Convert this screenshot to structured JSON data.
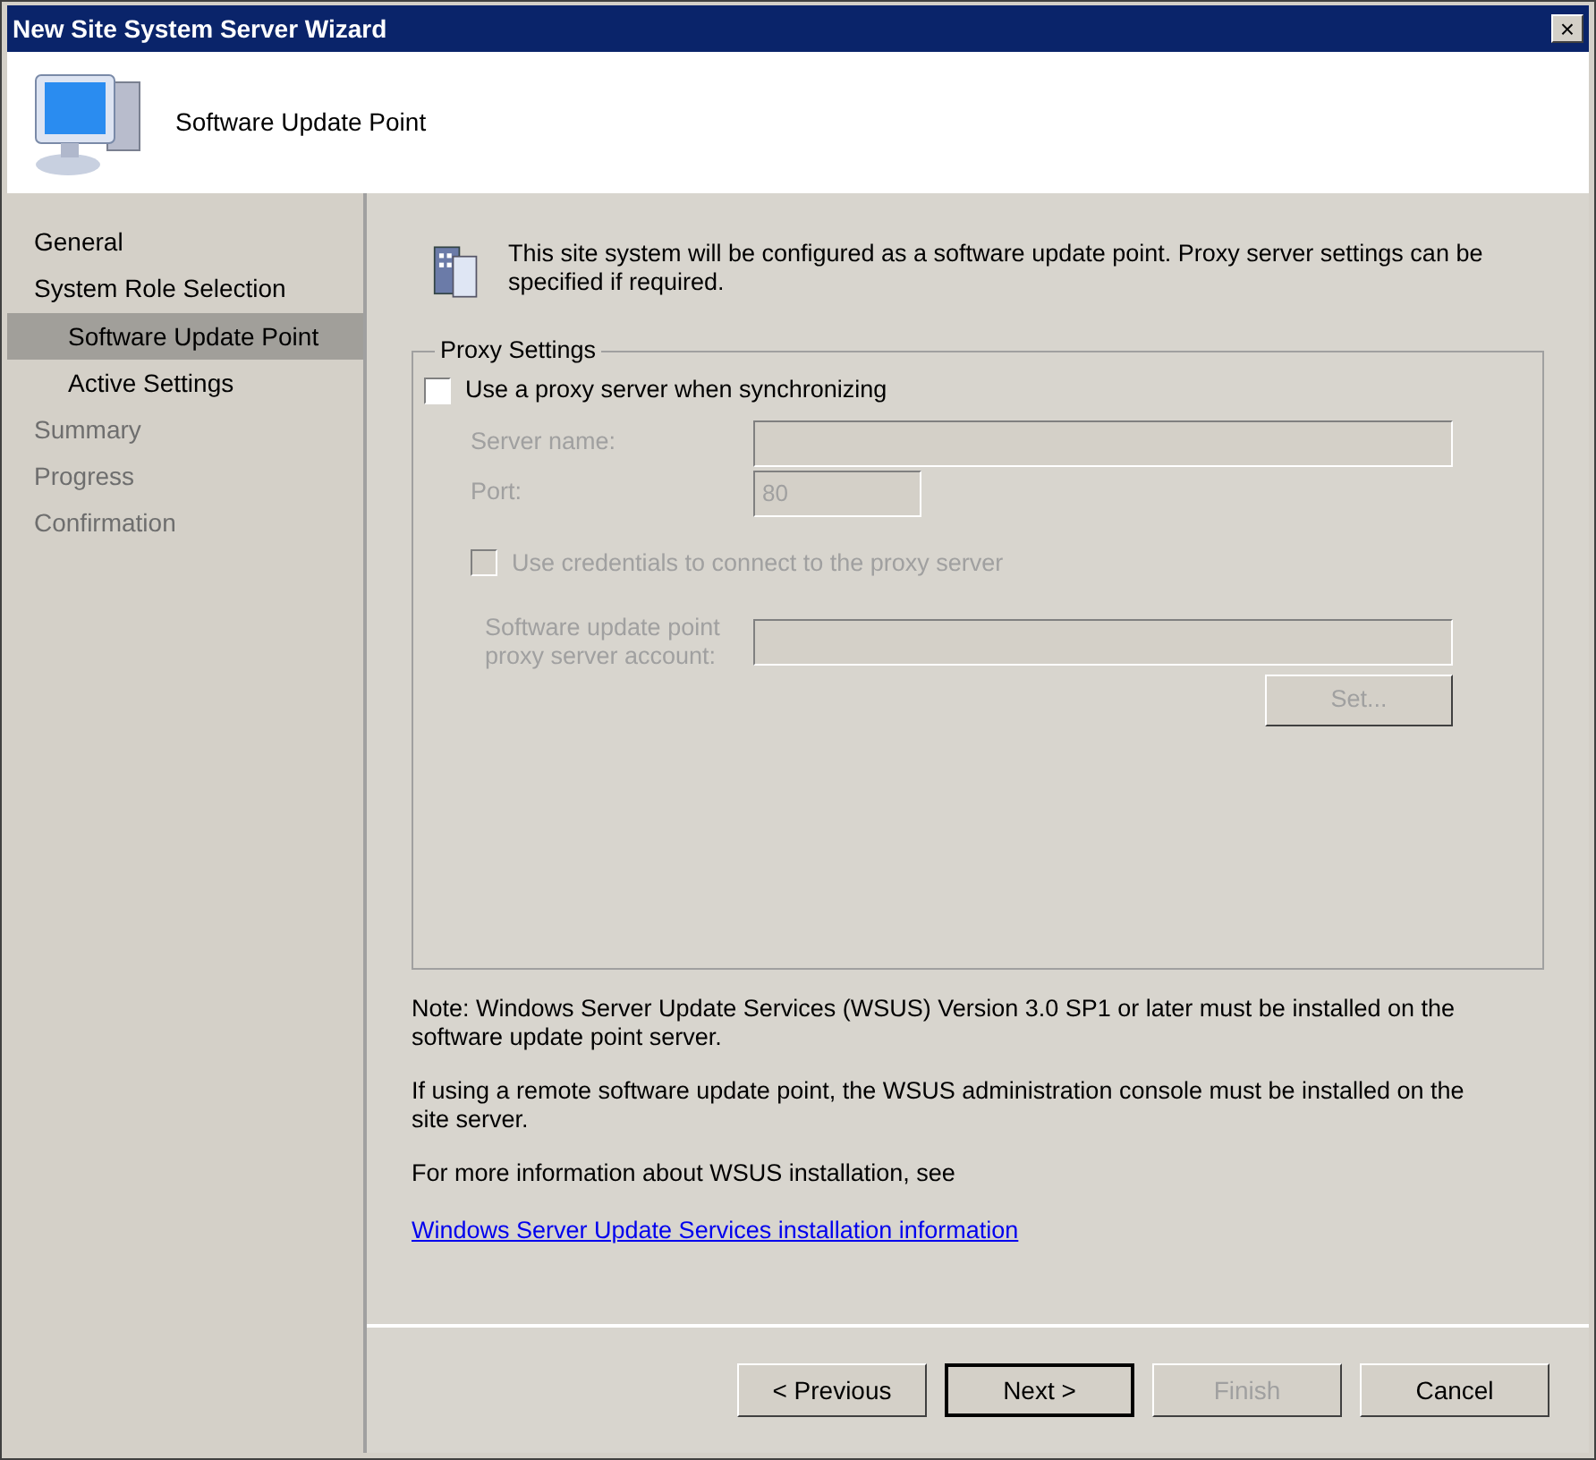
{
  "window": {
    "title": "New Site System Server Wizard",
    "close": "×"
  },
  "header": {
    "title": "Software Update Point"
  },
  "sidebar": {
    "items": [
      {
        "label": "General",
        "selected": false,
        "disabled": false
      },
      {
        "label": "System Role Selection",
        "selected": false,
        "disabled": false,
        "children": [
          {
            "label": "Software Update Point",
            "selected": true,
            "disabled": false
          },
          {
            "label": "Active Settings",
            "selected": false,
            "disabled": false
          }
        ]
      },
      {
        "label": "Summary",
        "selected": false,
        "disabled": true
      },
      {
        "label": "Progress",
        "selected": false,
        "disabled": true
      },
      {
        "label": "Confirmation",
        "selected": false,
        "disabled": true
      }
    ]
  },
  "intro": "This site system will be configured as a software update point. Proxy server settings can be specified if required.",
  "proxy_settings": {
    "legend": "Proxy Settings",
    "use_proxy": {
      "label": "Use a proxy server when synchronizing",
      "checked": false,
      "disabled": false
    },
    "server_name": {
      "label": "Server name:",
      "disabled": true
    },
    "port": {
      "label": "Port:",
      "value": "80",
      "disabled": true
    },
    "use_credentials": {
      "label": "Use credentials to connect to the proxy server",
      "checked": false,
      "disabled": true
    },
    "account": {
      "label": "Software update point proxy server account:",
      "disabled": true
    },
    "set_button": {
      "label": "Set...",
      "disabled": true
    }
  },
  "notes": [
    "Note: Windows Server Update Services (WSUS) Version 3.0 SP1 or later must be installed on the software update point server.",
    "If using a remote software update point, the WSUS administration console must be installed on the site server.",
    "For more information about WSUS installation, see"
  ],
  "link": "Windows Server Update Services installation information",
  "buttons": [
    {
      "label": "< Previous",
      "disabled": false,
      "default": false
    },
    {
      "label": "Next >",
      "disabled": false,
      "default": true
    },
    {
      "label": "Finish",
      "disabled": true,
      "default": false
    },
    {
      "label": "Cancel",
      "disabled": false,
      "default": false
    }
  ]
}
